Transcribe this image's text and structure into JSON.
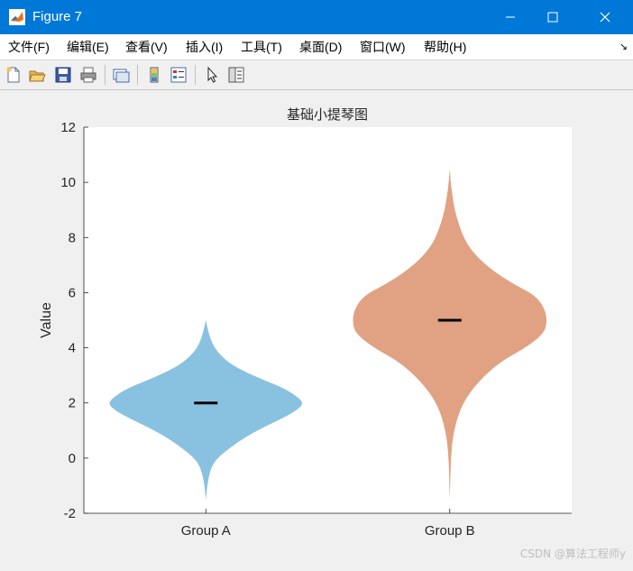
{
  "window": {
    "title": "Figure 7",
    "controls": [
      "minimize",
      "maximize",
      "close"
    ]
  },
  "menubar": {
    "items": [
      "文件(F)",
      "编辑(E)",
      "查看(V)",
      "插入(I)",
      "工具(T)",
      "桌面(D)",
      "窗口(W)",
      "帮助(H)"
    ]
  },
  "toolbar": {
    "icons": [
      "new-figure-icon",
      "open-file-icon",
      "save-icon",
      "print-icon",
      "link-plot-icon",
      "colorbar-icon",
      "legend-icon",
      "pointer-icon",
      "property-inspector-icon"
    ]
  },
  "watermark": "CSDN @算法工程师y",
  "chart_data": {
    "type": "violin",
    "title": "基础小提琴图",
    "xlabel": "",
    "ylabel": "Value",
    "categories": [
      "Group A",
      "Group B"
    ],
    "ylim": [
      -2,
      12
    ],
    "yticks": [
      -2,
      0,
      2,
      4,
      6,
      8,
      10,
      12
    ],
    "series": [
      {
        "category": "Group A",
        "color": "#89c2e0",
        "median": 2.0,
        "y_range": [
          -1.5,
          5.0
        ],
        "density_profile": [
          [
            -1.5,
            0.0
          ],
          [
            -0.8,
            0.02
          ],
          [
            -0.3,
            0.06
          ],
          [
            0.0,
            0.12
          ],
          [
            0.3,
            0.22
          ],
          [
            0.7,
            0.38
          ],
          [
            1.1,
            0.58
          ],
          [
            1.5,
            0.82
          ],
          [
            1.8,
            0.96
          ],
          [
            2.0,
            1.0
          ],
          [
            2.2,
            0.95
          ],
          [
            2.5,
            0.82
          ],
          [
            2.8,
            0.62
          ],
          [
            3.1,
            0.42
          ],
          [
            3.4,
            0.26
          ],
          [
            3.7,
            0.16
          ],
          [
            4.0,
            0.09
          ],
          [
            4.3,
            0.05
          ],
          [
            4.6,
            0.025
          ],
          [
            5.0,
            0.0
          ]
        ]
      },
      {
        "category": "Group B",
        "color": "#e0a283",
        "median": 5.0,
        "y_range": [
          -1.5,
          10.5
        ],
        "density_profile": [
          [
            -1.5,
            0.0
          ],
          [
            0.0,
            0.01
          ],
          [
            1.0,
            0.04
          ],
          [
            2.0,
            0.13
          ],
          [
            2.8,
            0.3
          ],
          [
            3.5,
            0.52
          ],
          [
            4.0,
            0.78
          ],
          [
            4.5,
            0.96
          ],
          [
            4.9,
            1.0
          ],
          [
            5.4,
            0.98
          ],
          [
            5.9,
            0.88
          ],
          [
            6.3,
            0.66
          ],
          [
            6.8,
            0.44
          ],
          [
            7.3,
            0.28
          ],
          [
            7.8,
            0.17
          ],
          [
            8.4,
            0.1
          ],
          [
            9.0,
            0.05
          ],
          [
            9.6,
            0.025
          ],
          [
            10.0,
            0.01
          ],
          [
            10.5,
            0.0
          ]
        ]
      }
    ],
    "grid": false,
    "legend": "none"
  }
}
